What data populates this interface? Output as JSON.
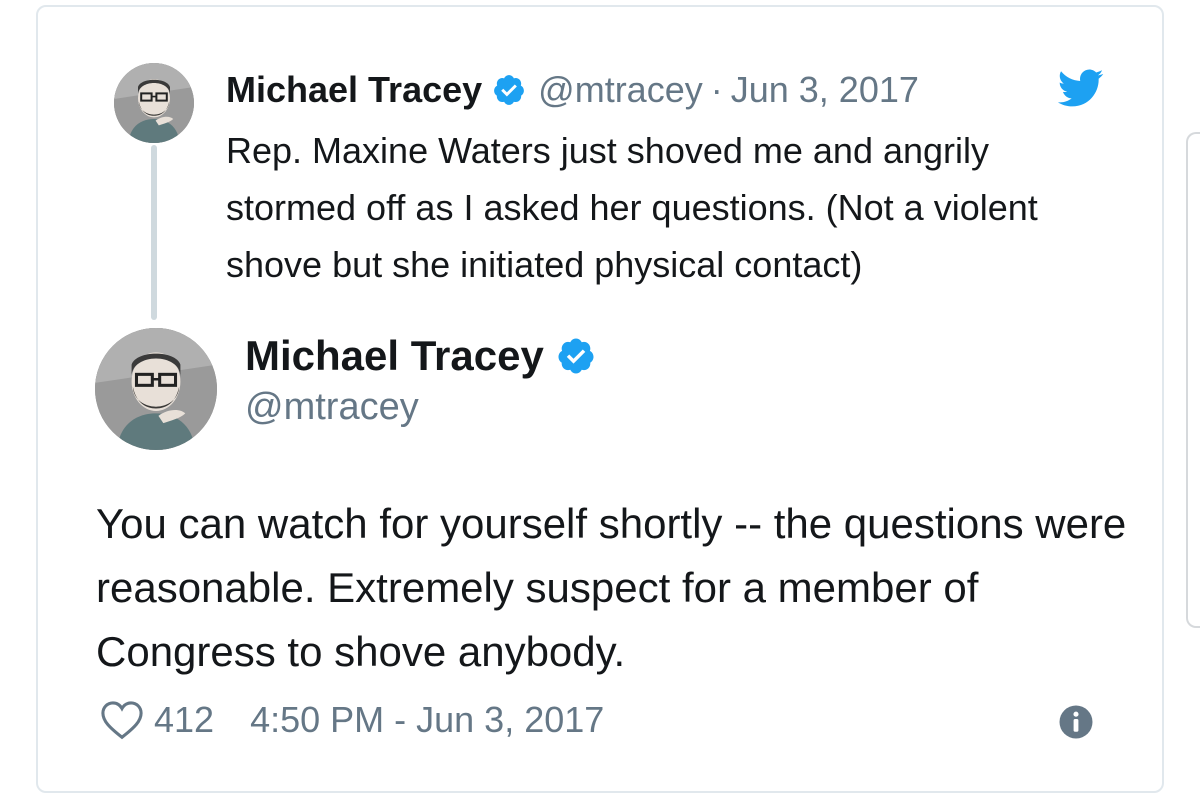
{
  "quoted_tweet": {
    "display_name": "Michael Tracey",
    "handle": "@mtracey",
    "separator": "·",
    "date": "Jun 3, 2017",
    "text": "Rep. Maxine Waters just shoved me and angrily stormed off as I asked her questions. (Not a violent shove but she initiated physical contact)"
  },
  "main_tweet": {
    "display_name": "Michael Tracey",
    "handle": "@mtracey",
    "text": "You can watch for yourself shortly -- the questions were reasonable. Extremely suspect for a member of Congress to shove anybody.",
    "likes": "412",
    "timestamp": "4:50 PM - Jun 3, 2017"
  },
  "icons": {
    "verified": "verified-badge-icon",
    "twitter": "twitter-bird-icon",
    "like": "heart-icon",
    "info": "info-icon"
  },
  "colors": {
    "brand_blue": "#1da1f2",
    "text_primary": "#14171a",
    "text_secondary": "#657786",
    "border": "#e1e8ed"
  }
}
